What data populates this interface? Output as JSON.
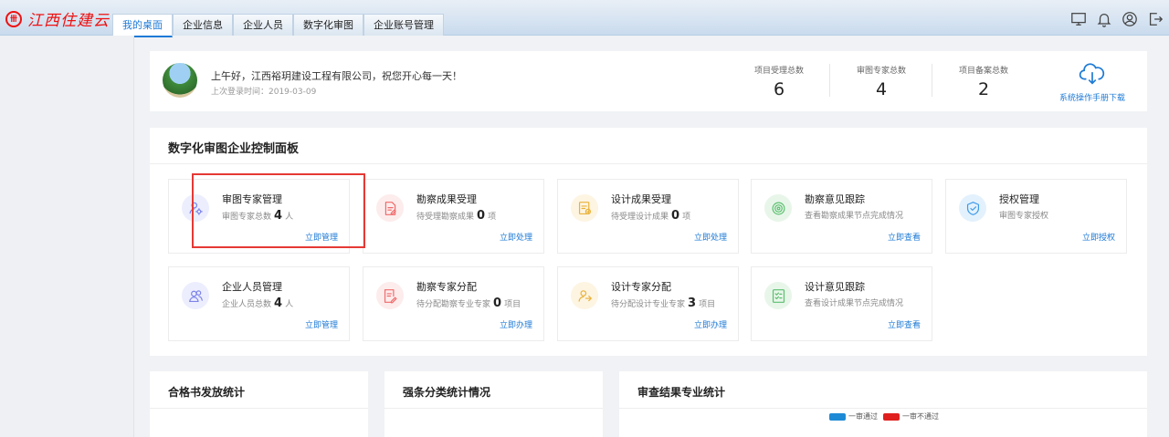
{
  "brand": {
    "name": "江西住建云",
    "mark": "卌"
  },
  "nav": {
    "tabs": [
      "我的桌面",
      "企业信息",
      "企业人员",
      "数字化审图",
      "企业账号管理"
    ]
  },
  "toolbar": {
    "icons": [
      "monitor-icon",
      "bell-icon",
      "user-circle-icon",
      "logout-icon"
    ]
  },
  "welcome": {
    "greeting": "上午好，江西裕玥建设工程有限公司，祝您开心每一天！",
    "last_login": "上次登录时间：2019-03-09",
    "stats": [
      {
        "label": "项目受理总数",
        "value": "6"
      },
      {
        "label": "审图专家总数",
        "value": "4"
      },
      {
        "label": "项目备案总数",
        "value": "2"
      }
    ],
    "download_label": "系统操作手册下载"
  },
  "panel": {
    "title": "数字化审图企业控制面板",
    "tiles": [
      {
        "title": "审图专家管理",
        "sub_pre": "审图专家总数",
        "num": "4",
        "sub_post": "人",
        "link": "立即管理",
        "icon": "expert-gear-icon",
        "color": "#7b83e8",
        "bg": "#eceefe"
      },
      {
        "title": "勘察成果受理",
        "sub_pre": "待受理勘察成果",
        "num": "0",
        "sub_post": "项",
        "link": "立即处理",
        "icon": "document-edit-icon",
        "color": "#ef6b6b",
        "bg": "#fdecec"
      },
      {
        "title": "设计成果受理",
        "sub_pre": "待受理设计成果",
        "num": "0",
        "sub_post": "项",
        "link": "立即处理",
        "icon": "document-check-icon",
        "color": "#e9b23a",
        "bg": "#fdf4e2"
      },
      {
        "title": "勘察意见跟踪",
        "sub_pre": "查看勘察成果节点完成情况",
        "num": "",
        "sub_post": "",
        "link": "立即查看",
        "icon": "target-icon",
        "color": "#5bbf6e",
        "bg": "#e8f6ea"
      },
      {
        "title": "授权管理",
        "sub_pre": "审图专家授权",
        "num": "",
        "sub_post": "",
        "link": "立即授权",
        "icon": "shield-check-icon",
        "color": "#3d9be9",
        "bg": "#e3f1fd"
      },
      {
        "title": "企业人员管理",
        "sub_pre": "企业人员总数",
        "num": "4",
        "sub_post": "人",
        "link": "立即管理",
        "icon": "people-icon",
        "color": "#7b83e8",
        "bg": "#eceefe"
      },
      {
        "title": "勘察专家分配",
        "sub_pre": "待分配勘察专业专家",
        "num": "0",
        "sub_post": "项目",
        "link": "立即办理",
        "icon": "assign-edit-icon",
        "color": "#ef6b6b",
        "bg": "#fdecec"
      },
      {
        "title": "设计专家分配",
        "sub_pre": "待分配设计专业专家",
        "num": "3",
        "sub_post": "项目",
        "link": "立即办理",
        "icon": "user-assign-icon",
        "color": "#e9b23a",
        "bg": "#fdf4e2"
      },
      {
        "title": "设计意见跟踪",
        "sub_pre": "查看设计成果节点完成情况",
        "num": "",
        "sub_post": "",
        "link": "立即查看",
        "icon": "checklist-icon",
        "color": "#5bbf6e",
        "bg": "#e8f6ea"
      }
    ]
  },
  "bottom": {
    "cards": [
      "合格书发放统计",
      "强条分类统计情况",
      "审查结果专业统计"
    ],
    "legend": [
      {
        "label": "一审通过",
        "color": "#1e8ad6"
      },
      {
        "label": "一审不通过",
        "color": "#e0201f"
      }
    ]
  }
}
